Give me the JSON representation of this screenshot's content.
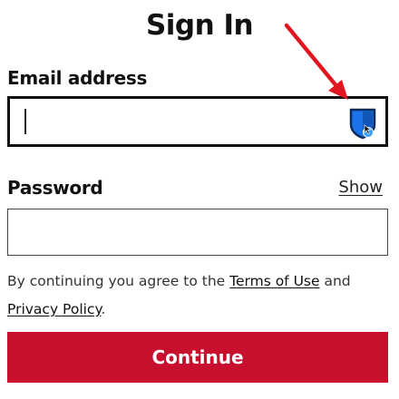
{
  "title": "Sign In",
  "email": {
    "label": "Email address",
    "value": "",
    "placeholder": ""
  },
  "password": {
    "label": "Password",
    "show_label": "Show",
    "value": "",
    "placeholder": ""
  },
  "terms": {
    "prefix": "By continuing you agree to the ",
    "terms_link": "Terms of Use",
    "middle": " and",
    "privacy_link": "Privacy Policy",
    "suffix": "."
  },
  "continue_label": "Continue",
  "colors": {
    "primary": "#c8102e",
    "annotation": "#e0151f",
    "password_manager_icon": "#1a73e8"
  },
  "icons": {
    "password_manager": "shield-icon",
    "annotation": "arrow-icon"
  }
}
